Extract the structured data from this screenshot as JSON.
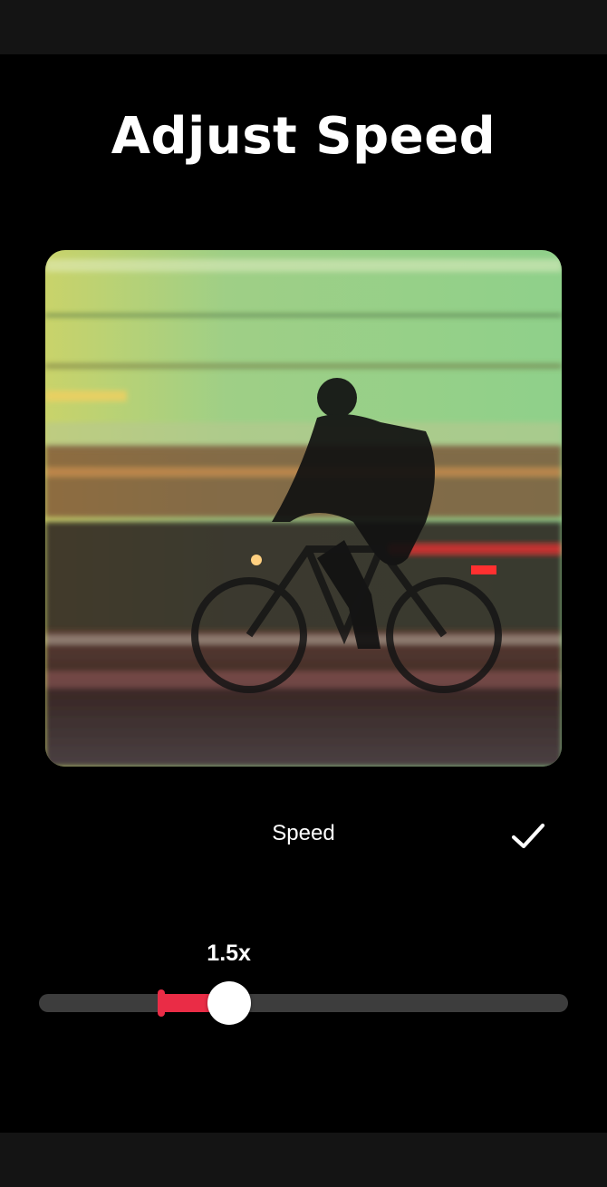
{
  "screen": {
    "title": "Adjust Speed"
  },
  "preview": {
    "description_icon": "video-preview-image"
  },
  "controls": {
    "label": "Speed",
    "confirm_icon": "checkmark-icon"
  },
  "speed_slider": {
    "value_label": "1.5x",
    "min": 0.1,
    "max": 4,
    "origin": 1,
    "value": 1.5,
    "accent_color": "#ea2c46",
    "track_color": "#3d3d3d"
  }
}
